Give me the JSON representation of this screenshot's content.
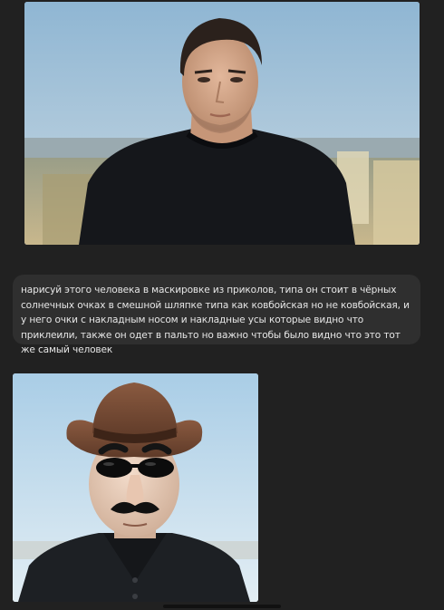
{
  "chat": {
    "user_photo": {
      "icon": "photo-of-man-in-black-tshirt"
    },
    "user_message": {
      "text": "нарисуй этого человека в маскировке из приколов, типа он стоит в чёрных солнечных очках в смешной шляпке типа как ковбойская но не ковбойская, и у него очки с накладным носом и накладные усы которые видно что приклеили, также он одет в пальто но важно чтобы было видно что это тот же самый человек"
    },
    "generated_image": {
      "icon": "disguised-man-cowboy-hat-sunglasses"
    }
  },
  "colors": {
    "background": "#212121",
    "bubble": "#2f2f2f",
    "text": "#e6e6e6"
  }
}
